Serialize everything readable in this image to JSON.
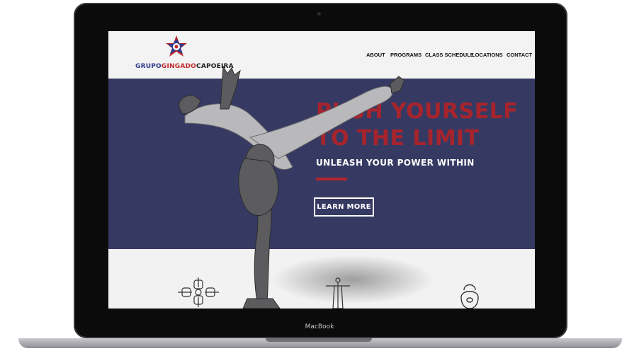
{
  "device": {
    "brand_label": "MacBook"
  },
  "site": {
    "logo": {
      "part1": "GRUPO",
      "part2": "GINGADO",
      "part3": "CAPOEIRA",
      "icon": "star-emblem-icon"
    },
    "nav": {
      "items": [
        "ABOUT",
        "PROGRAMS",
        "CLASS SCHEDULE",
        "LOCATIONS",
        "CONTACT"
      ]
    },
    "hero": {
      "title_line1": "PUSH YOURSELF",
      "title_line2": "TO THE LIMIT",
      "subtitle": "UNLEASH YOUR POWER WITHIN",
      "cta_label": "LEARN MORE"
    },
    "features": {
      "icons": [
        "hands-circle-icon",
        "christ-statue-icon",
        "kettlebell-icon"
      ]
    }
  },
  "colors": {
    "hero_bg": "#363a62",
    "accent_red": "#a8242c",
    "brand_blue": "#2e3a8c"
  }
}
